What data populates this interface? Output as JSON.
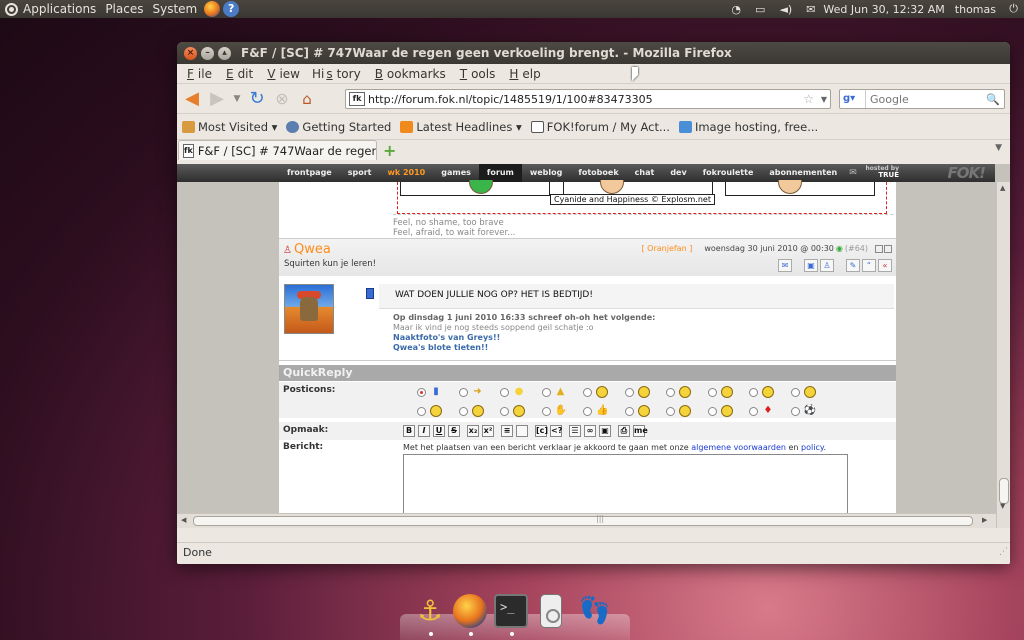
{
  "top_panel": {
    "menus": [
      "Applications",
      "Places",
      "System"
    ],
    "clock": "Wed Jun 30, 12:32 AM",
    "user": "thomas"
  },
  "window": {
    "title": "F&F / [SC] # 747Waar de regen geen verkoeling brengt. - Mozilla Firefox",
    "menubar": [
      {
        "pre": "",
        "u": "F",
        "post": "ile"
      },
      {
        "pre": "",
        "u": "E",
        "post": "dit"
      },
      {
        "pre": "",
        "u": "V",
        "post": "iew"
      },
      {
        "pre": "Hi",
        "u": "s",
        "post": "tory"
      },
      {
        "pre": "",
        "u": "B",
        "post": "ookmarks"
      },
      {
        "pre": "",
        "u": "T",
        "post": "ools"
      },
      {
        "pre": "",
        "u": "H",
        "post": "elp"
      }
    ],
    "url": "http://forum.fok.nl/topic/1485519/1/100#83473305",
    "search_placeholder": "Google",
    "bookmarks": [
      "Most Visited ▾",
      "Getting Started",
      "Latest Headlines ▾",
      "FOK!forum / My Act...",
      "Image hosting, free..."
    ],
    "tab_label": "F&F / [SC] # 747Waar de regen...",
    "status": "Done"
  },
  "site": {
    "nav": [
      {
        "label": "frontpage",
        "state": ""
      },
      {
        "label": "sport",
        "state": ""
      },
      {
        "label": "wk 2010",
        "state": "hot"
      },
      {
        "label": "games",
        "state": ""
      },
      {
        "label": "forum",
        "state": "active"
      },
      {
        "label": "weblog",
        "state": ""
      },
      {
        "label": "fotoboek",
        "state": ""
      },
      {
        "label": "chat",
        "state": ""
      },
      {
        "label": "dev",
        "state": ""
      },
      {
        "label": "fokroulette",
        "state": ""
      },
      {
        "label": "abonnementen",
        "state": ""
      }
    ],
    "hosted_by": "hosted by",
    "hosted_logo": "TRUE",
    "logo": "FOK!"
  },
  "prev_post": {
    "comic_credit": "Cyanide and Happiness © Explosm.net",
    "sig_line1": "Feel, no shame, too brave",
    "sig_line2": "Feel, afraid, to wait forever..."
  },
  "post": {
    "username": "Qwea",
    "user_title": "Squirten kun je leren!",
    "tag": "[ Oranjefan ]",
    "date": "woensdag 30 juni 2010 @ 00:30",
    "post_number": "(#64)",
    "text": "WAT DOEN JULLIE NOG OP? HET IS BEDTIJD!",
    "quote_header": "Op dinsdag 1 juni 2010 16:33 schreef oh-oh het volgende:",
    "quote_body": "Maar ik vind je nog steeds soppend geil schatje :o",
    "links": [
      "Naaktfoto's van Greys!!",
      "Qwea's blote tieten!!"
    ]
  },
  "quickreply": {
    "title": "QuickReply",
    "posticons_label": "Posticons:",
    "opmaak_label": "Opmaak:",
    "bericht_label": "Bericht:",
    "disclaimer_pre": "Met het plaatsen van een bericht verklaar je akkoord te gaan met onze ",
    "disclaimer_link1": "algemene voorwaarden",
    "disclaimer_mid": " en ",
    "disclaimer_link2": "policy",
    "disclaimer_post": ".",
    "format_buttons": [
      "B",
      "I",
      "U",
      "S",
      "x₂",
      "x²",
      "≡",
      "",
      "[c]",
      "<?",
      "☰",
      "∞",
      "▣",
      "⎙",
      "me"
    ],
    "posticons": [
      {
        "name": "doc-icon",
        "glyph": "▮",
        "color": "#3a6ad4",
        "selected": true
      },
      {
        "name": "arrow-icon",
        "glyph": "➜",
        "color": "#d8a010"
      },
      {
        "name": "bulb-icon",
        "glyph": "●",
        "color": "#f5d33a"
      },
      {
        "name": "warning-icon",
        "glyph": "▲",
        "color": "#e0b020"
      },
      {
        "name": "smile-icon",
        "glyph": "",
        "color": "#f5d33a"
      },
      {
        "name": "cool-icon",
        "glyph": "",
        "color": "#f5d33a"
      },
      {
        "name": "grin-icon",
        "glyph": "",
        "color": "#f5d33a"
      },
      {
        "name": "wink-icon",
        "glyph": "",
        "color": "#f5d33a"
      },
      {
        "name": "sad-icon",
        "glyph": "",
        "color": "#f5d33a"
      },
      {
        "name": "laugh-icon",
        "glyph": "",
        "color": "#f5d33a"
      },
      {
        "name": "big-grin-icon",
        "glyph": "",
        "color": "#f5d33a"
      },
      {
        "name": "shocked-icon",
        "glyph": "",
        "color": "#f5d33a"
      },
      {
        "name": "confused-icon",
        "glyph": "",
        "color": "#f5d33a"
      },
      {
        "name": "hand-icon",
        "glyph": "✋",
        "color": "#e0b020"
      },
      {
        "name": "thumbs-up-icon",
        "glyph": "👍",
        "color": "#e0b020"
      },
      {
        "name": "neutral-icon",
        "glyph": "",
        "color": "#f5d33a"
      },
      {
        "name": "tongue-icon",
        "glyph": "",
        "color": "#f5d33a"
      },
      {
        "name": "surprised-icon",
        "glyph": "",
        "color": "#f5d33a"
      },
      {
        "name": "superman-icon",
        "glyph": "♦",
        "color": "#d82020"
      },
      {
        "name": "soccer-ball-icon",
        "glyph": "⚽",
        "color": "#222"
      }
    ]
  },
  "dock": {
    "apps": [
      "anchor",
      "firefox",
      "terminal",
      "ipod",
      "feet"
    ]
  }
}
